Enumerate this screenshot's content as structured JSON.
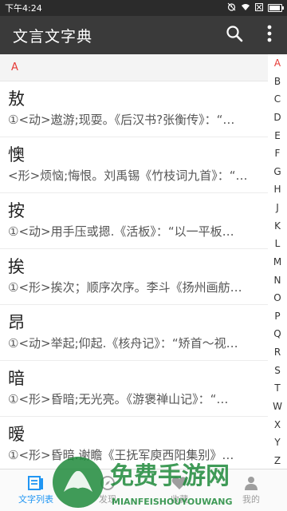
{
  "status_bar": {
    "time": "下午4:24",
    "icons": [
      "alarm-icon",
      "wifi-icon",
      "sim-icon",
      "battery-icon"
    ],
    "battery_level": 0.9
  },
  "app_bar": {
    "title": "文言文字典",
    "search_icon": "search-icon",
    "menu_icon": "more-vert-icon"
  },
  "section_header": {
    "letter": "A"
  },
  "entries": [
    {
      "char": "敖",
      "definition": "①<动>遨游;现耍。《后汉书?张衡传》：“…"
    },
    {
      "char": "懊",
      "definition": "<形>烦恼;悔恨。刘禹锡《竹枝词九首》：“…"
    },
    {
      "char": "按",
      "definition": "①<动>用手压或摁.《活板》：“以一平板…"
    },
    {
      "char": "挨",
      "definition": "①<形>挨次；顺序次序。李斗《扬州画舫…"
    },
    {
      "char": "昂",
      "definition": "①<动>举起;仰起.《核舟记》：“矫首～视…"
    },
    {
      "char": "暗",
      "definition": "①<形>昏暗;无光亮。《游褒禅山记》：“…"
    },
    {
      "char": "暧",
      "definition": "①<形>昏暗.谢瞻《王抚军庾西阳集别》…"
    }
  ],
  "index_letters": [
    "A",
    "B",
    "C",
    "D",
    "E",
    "F",
    "G",
    "H",
    "J",
    "K",
    "L",
    "M",
    "N",
    "O",
    "P",
    "Q",
    "R",
    "S",
    "T",
    "W",
    "X",
    "Y",
    "Z"
  ],
  "index_active": "A",
  "bottom_nav": [
    {
      "label": "文字列表",
      "icon": "list-icon",
      "active": true
    },
    {
      "label": "发现",
      "icon": "compass-icon",
      "active": false
    },
    {
      "label": "收藏",
      "icon": "heart-icon",
      "active": false
    },
    {
      "label": "我的",
      "icon": "person-icon",
      "active": false
    }
  ],
  "watermark": {
    "title": "免费手游网",
    "subtitle": "MIANFEISHOUYOUWANG"
  },
  "colors": {
    "appbar": "#3a3a3a",
    "accent_red": "#e53935",
    "nav_active": "#2196f3",
    "watermark_green": "#1f8a3b"
  }
}
